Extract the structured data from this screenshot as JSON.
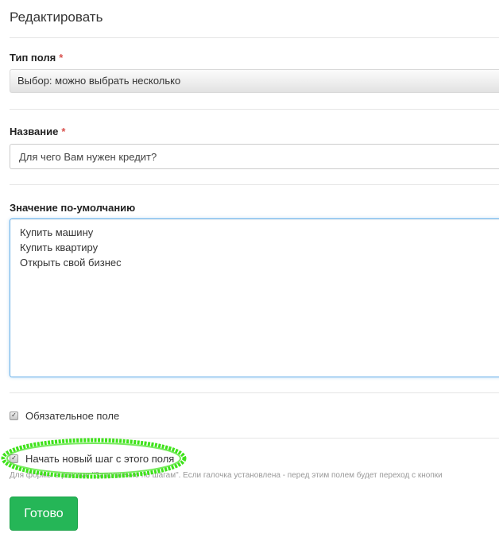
{
  "dialog": {
    "title": "Редактировать"
  },
  "field_type": {
    "label": "Тип поля",
    "required_mark": "*",
    "value": "Выбор: можно выбрать несколько"
  },
  "name": {
    "label": "Название",
    "required_mark": "*",
    "value": "Для чего Вам нужен кредит?"
  },
  "default_value": {
    "label": "Значение по-умолчанию",
    "value": "Купить машину\nКупить квартиру\nОткрыть свой бизнес"
  },
  "required_checkbox": {
    "label": "Обязательное поле",
    "checked": true
  },
  "new_step_checkbox": {
    "label": "Начать новый шаг с этого поля",
    "checked": true,
    "help": "Для формы в режиме \"Заполнение по шагам\". Если галочка установлена - перед этим полем будет переход с кнопки"
  },
  "actions": {
    "done_label": "Готово"
  },
  "colors": {
    "primary_button": "#25b657",
    "required_mark": "#d9534f",
    "highlight_annotation": "#3fe21b",
    "focus_border": "#66afe9"
  }
}
